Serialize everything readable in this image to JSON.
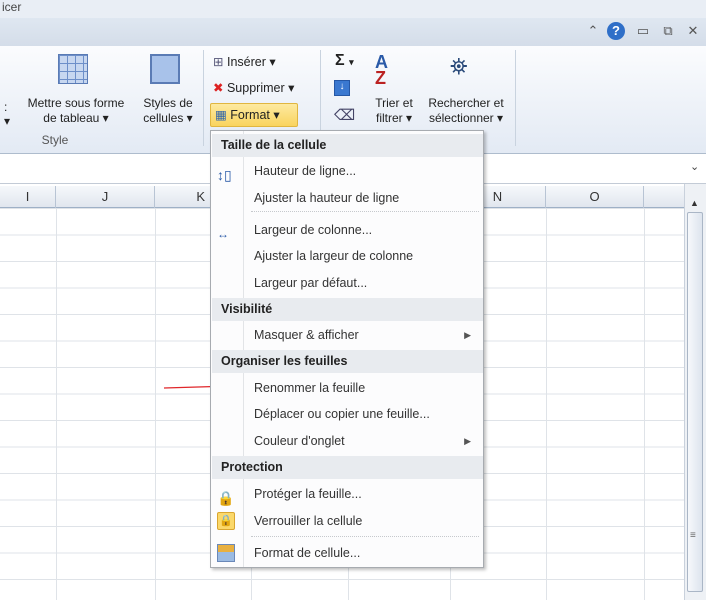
{
  "window": {
    "title_fragment": "icer",
    "controls": [
      "ribbon-minimize",
      "help",
      "minimize",
      "restore",
      "close"
    ]
  },
  "ribbon": {
    "style_group": {
      "label": "Style",
      "buttons": [
        {
          "label1": "Mettre sous forme",
          "label2": "de tableau"
        },
        {
          "label1": "Styles de",
          "label2": "cellules"
        }
      ]
    },
    "cells_group": {
      "insert": "Insérer",
      "delete": "Supprimer",
      "format": "Format"
    },
    "editing_group": {
      "sum": "Σ",
      "sort_label1": "Trier et",
      "sort_label2": "filtrer",
      "find_label1": "Rechercher et",
      "find_label2": "sélectionner"
    }
  },
  "columns": [
    "I",
    "J",
    "K",
    "N",
    "O"
  ],
  "menu": {
    "sections": [
      {
        "header": "Taille de la cellule",
        "items": [
          "Hauteur de ligne...",
          "Ajuster la hauteur de ligne",
          "Largeur de colonne...",
          "Ajuster la largeur de colonne",
          "Largeur par défaut..."
        ]
      },
      {
        "header": "Visibilité",
        "items": [
          "Masquer & afficher"
        ]
      },
      {
        "header": "Organiser les feuilles",
        "items": [
          "Renommer la feuille",
          "Déplacer ou copier une feuille...",
          "Couleur d'onglet"
        ]
      },
      {
        "header": "Protection",
        "items": [
          "Protéger la feuille...",
          "Verrouiller la cellule",
          "Format de cellule..."
        ]
      }
    ]
  },
  "colors": {
    "annotation_arrow": "#e0262a",
    "format_highlight": "#f9d45e",
    "help_blue": "#2f6fc8"
  }
}
